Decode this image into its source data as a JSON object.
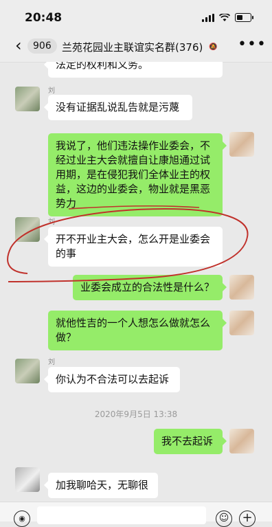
{
  "status": {
    "time": "20:48"
  },
  "header": {
    "back_count": "906",
    "title": "兰苑花园业主联谊实名群(376)"
  },
  "messages": [
    {
      "side": "left",
      "text": "法定的权利和义务。"
    },
    {
      "side": "left",
      "sender": "刘",
      "text": "没有证据乱说乱告就是污蔑"
    },
    {
      "side": "right",
      "text": "我说了，他们违法操作业委会，不经过业主大会就擅自让康旭通过试用期，是在侵犯我们全体业主的权益，这边的业委会，物业就是黑恶势力"
    },
    {
      "side": "left",
      "sender": "刘",
      "text": "开不开业主大会，怎么开是业委会的事"
    },
    {
      "side": "right",
      "text": "业委会成立的合法性是什么？"
    },
    {
      "side": "right",
      "text": "就他性吉的一个人想怎么做就怎么做？"
    },
    {
      "side": "left",
      "sender": "刘",
      "text": "你认为不合法可以去起诉"
    },
    {
      "side": "right",
      "text": "我不去起诉"
    },
    {
      "side": "left",
      "text": "加我聊哈天，无聊很"
    }
  ],
  "timestamp": "2020年9月5日 13:38",
  "icons": {
    "back": "chevron-left-icon",
    "mute": "bell-off-icon",
    "more": "more-icon",
    "voice": "voice-icon",
    "emoji": "emoji-icon",
    "plus": "plus-icon"
  },
  "colors": {
    "sent_bubble": "#95ec69",
    "received_bubble": "#ffffff",
    "annotation": "#c0312b"
  }
}
